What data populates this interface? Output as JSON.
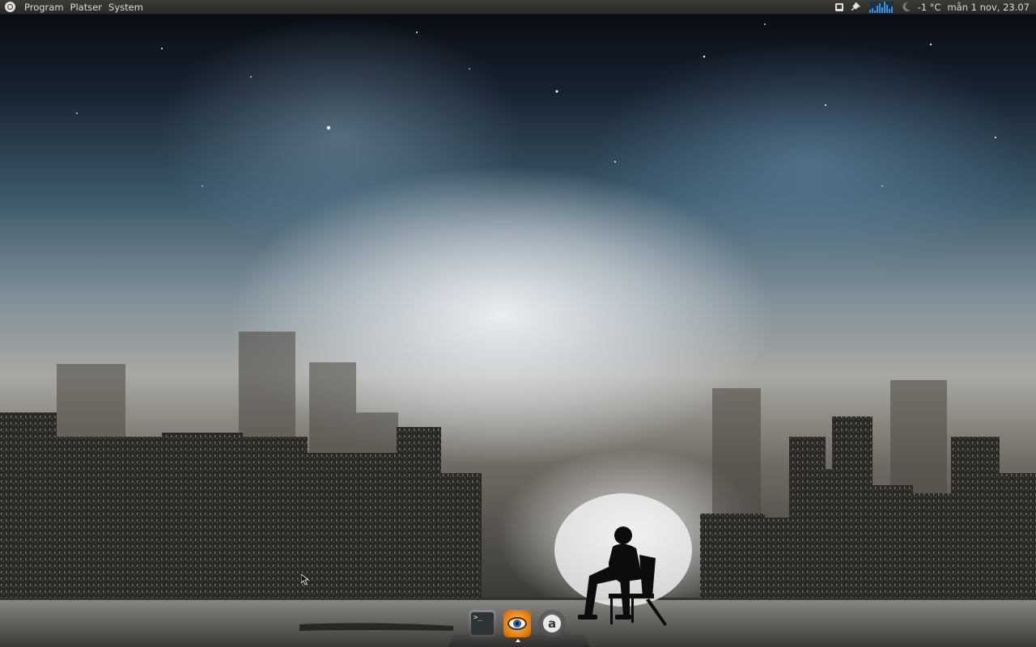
{
  "top_panel": {
    "menus": [
      {
        "label": "Program"
      },
      {
        "label": "Platser"
      },
      {
        "label": "System"
      }
    ],
    "logo_icon": "ubuntu-logo-icon",
    "tray": {
      "icons": [
        "screen-icon",
        "pin-icon",
        "system-monitor-icon",
        "weather-night-icon"
      ],
      "temperature": "-1 °C",
      "clock": "mån  1 nov, 23.07"
    }
  },
  "dock": {
    "items": [
      {
        "name": "Terminal",
        "icon": "terminal-icon",
        "glyph": ">_"
      },
      {
        "name": "Web browser",
        "icon": "browser-eye-icon",
        "active": true
      },
      {
        "name": "Store",
        "icon": "store-icon",
        "glyph": "a"
      }
    ]
  },
  "desktop": {
    "wallpaper": "night-sky-city-silhouette",
    "colors": {
      "panel": "#3c3b37",
      "panel_text": "#dfdbd2",
      "sky_dark": "#07090d",
      "sky_blue": "#3b5668",
      "haze": "#f0f2f5",
      "browser_orange": "#e07b12"
    }
  }
}
